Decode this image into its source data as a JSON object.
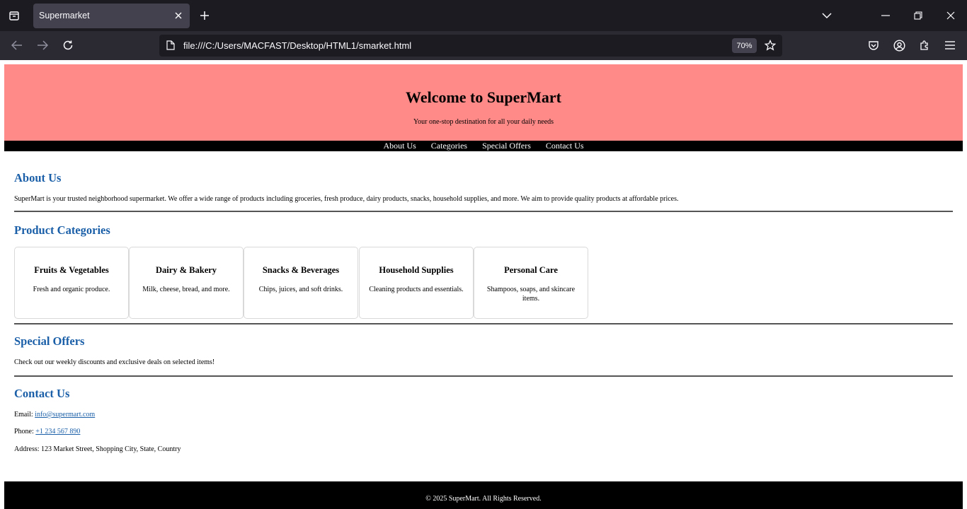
{
  "browser": {
    "tab_title": "Supermarket",
    "url": "file:///C:/Users/MACFAST/Desktop/HTML1/smarket.html",
    "zoom": "70%"
  },
  "hero": {
    "title": "Welcome to SuperMart",
    "subtitle": "Your one-stop destination for all your daily needs"
  },
  "menu": {
    "about": "About Us",
    "categories": "Categories",
    "offers": "Special Offers",
    "contact": "Contact Us"
  },
  "about": {
    "title": "About Us",
    "text": "SuperMart is your trusted neighborhood supermarket. We offer a wide range of products including groceries, fresh produce, dairy products, snacks, household supplies, and more. We aim to provide quality products at affordable prices."
  },
  "categories": {
    "title": "Product Categories",
    "items": [
      {
        "name": "Fruits & Vegetables",
        "desc": "Fresh and organic produce."
      },
      {
        "name": "Dairy & Bakery",
        "desc": "Milk, cheese, bread, and more."
      },
      {
        "name": "Snacks & Beverages",
        "desc": "Chips, juices, and soft drinks."
      },
      {
        "name": "Household Supplies",
        "desc": "Cleaning products and essentials."
      },
      {
        "name": "Personal Care",
        "desc": "Shampoos, soaps, and skincare items."
      }
    ]
  },
  "offers": {
    "title": "Special Offers",
    "text": "Check out our weekly discounts and exclusive deals on selected items!"
  },
  "contact": {
    "title": "Contact Us",
    "email_label": "Email: ",
    "email": "info@supermart.com",
    "phone_label": "Phone: ",
    "phone": "+1 234 567 890",
    "address": "Address: 123 Market Street, Shopping City, State, Country"
  },
  "footer": {
    "text": "© 2025 SuperMart. All Rights Reserved."
  },
  "colors": {
    "hero_bg": "#ff8a88",
    "heading": "#1a5fa8",
    "chrome_bg": "#1c1b22"
  }
}
